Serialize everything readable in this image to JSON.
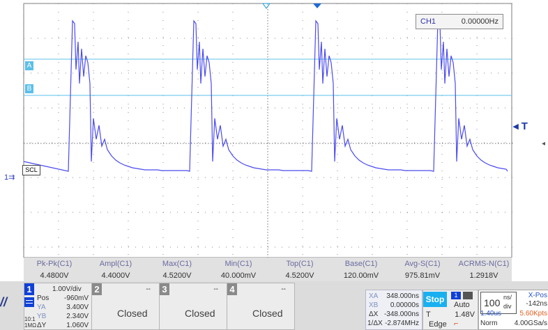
{
  "screen": {
    "freq": {
      "channel": "CH1",
      "value": "0.00000Hz"
    },
    "markers": {
      "a": "A",
      "b": "B",
      "scl": "SCL",
      "ch1": "1",
      "trigger": "T"
    }
  },
  "colors": {
    "trace": "#4a4af0",
    "cursor_line": "#5bc0e8",
    "grid_dots": "#8a8a8a",
    "stop": "#1ab0f0"
  },
  "measurements": [
    {
      "name": "Pk-Pk(C1)",
      "value": "4.4800V"
    },
    {
      "name": "Ampl(C1)",
      "value": "4.4000V"
    },
    {
      "name": "Max(C1)",
      "value": "4.5200V"
    },
    {
      "name": "Min(C1)",
      "value": "40.000mV"
    },
    {
      "name": "Top(C1)",
      "value": "4.5200V"
    },
    {
      "name": "Base(C1)",
      "value": "120.00mV"
    },
    {
      "name": "Avg-S(C1)",
      "value": "975.81mV"
    },
    {
      "name": "ACRMS-N(C1)",
      "value": "1.2918V"
    }
  ],
  "channel1": {
    "num": "1",
    "vdiv": "1.00V/div",
    "pos_label": "Pos",
    "pos": "-960mV",
    "ya_label": "YA",
    "ya": "3.400V",
    "yb_label": "YB",
    "yb": "2.340V",
    "dy_label": "ΔY",
    "dy": "1.060V",
    "coupling": "1MΩ",
    "bw": "10:1"
  },
  "closed_channels": [
    {
      "num": "2",
      "label": "Closed",
      "dash": "--"
    },
    {
      "num": "3",
      "label": "Closed",
      "dash": "--"
    },
    {
      "num": "4",
      "label": "Closed",
      "dash": "--"
    }
  ],
  "cursors": {
    "xa_label": "XA",
    "xa": "348.000ns",
    "xb_label": "XB",
    "xb": "0.00000s",
    "dx_label": "ΔX",
    "dx": "-348.000ns",
    "inv_label": "1/ΔX",
    "inv": "-2.874MHz"
  },
  "trigger": {
    "state": "Stop",
    "source": "1",
    "mode": "Auto",
    "type_label": "T",
    "level": "1.48V",
    "edge": "Edge"
  },
  "timebase": {
    "value": "100",
    "unit_top": "ns/",
    "unit_bottom": "div",
    "xpos_label": "X-Pos",
    "xpos": "-142ns",
    "delay": "1.40us",
    "points": "5.60Kpts",
    "mode": "Norm",
    "rate": "4.00GSa/s"
  }
}
